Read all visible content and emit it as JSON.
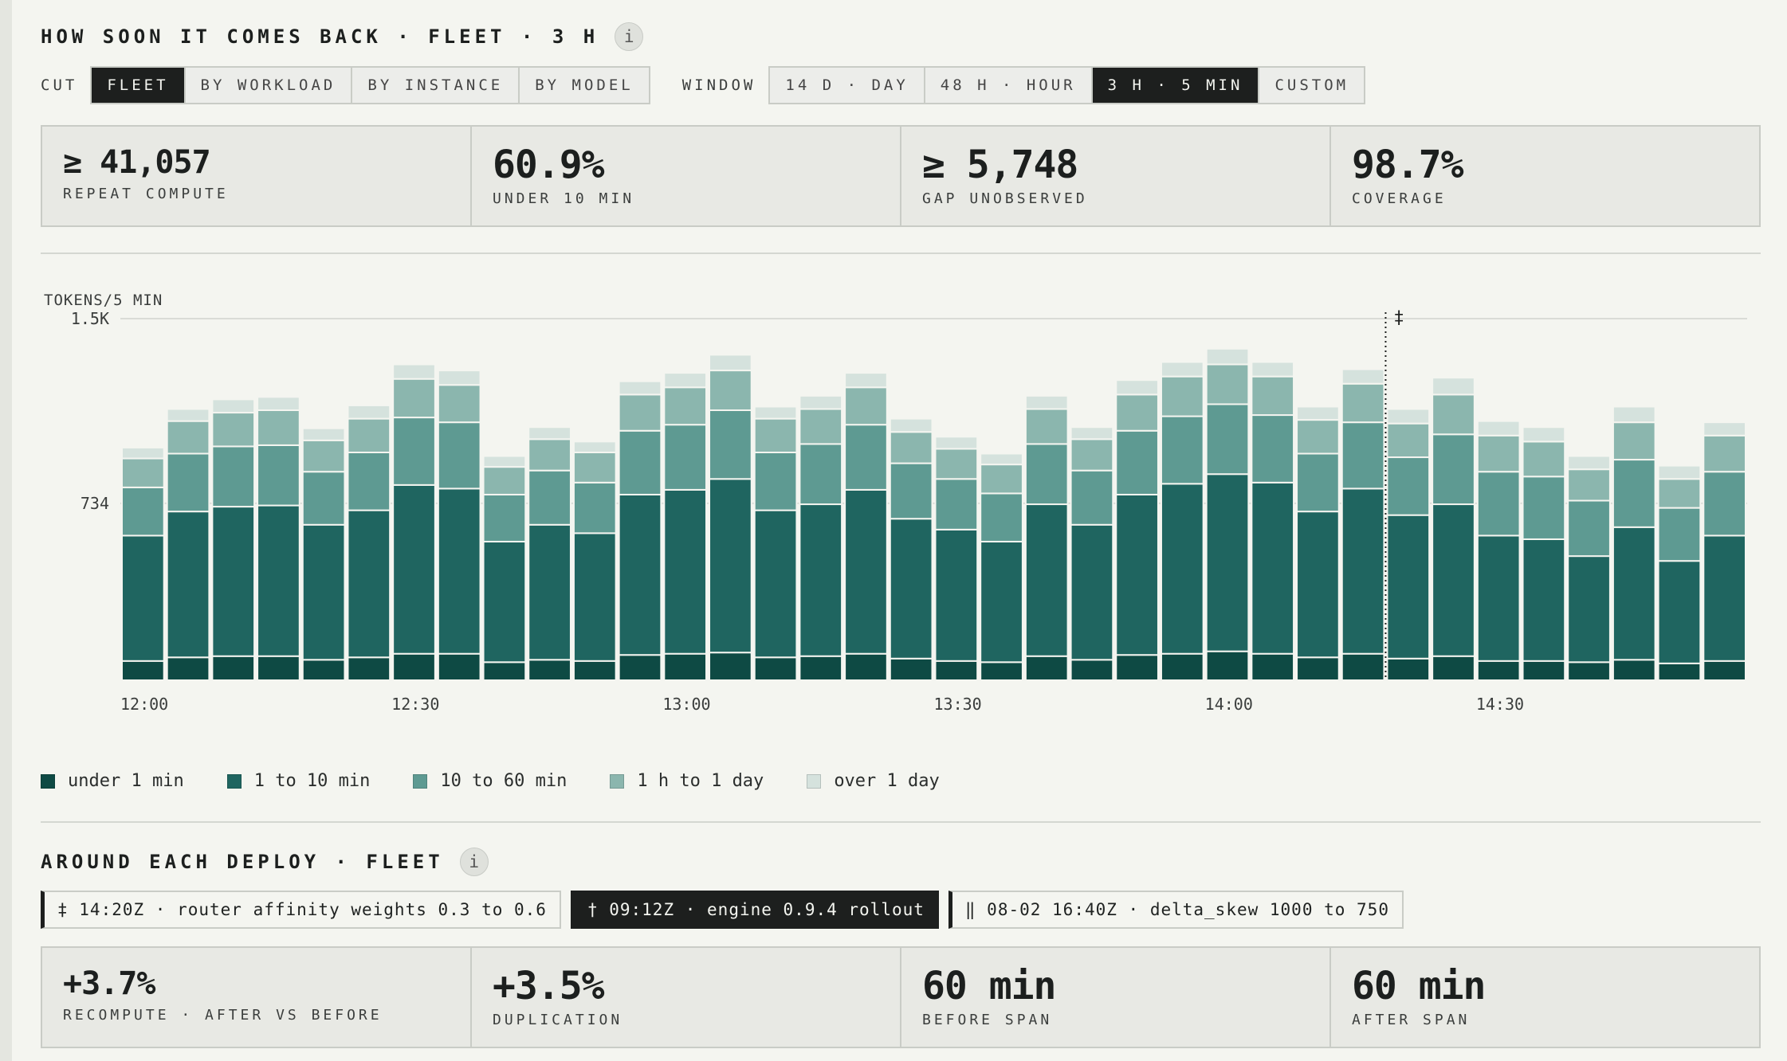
{
  "header": {
    "title": "HOW SOON IT COMES BACK · FLEET · 3 H",
    "info": "i"
  },
  "controls": {
    "cut_label": "CUT",
    "cut_options": [
      "FLEET",
      "BY WORKLOAD",
      "BY INSTANCE",
      "BY MODEL"
    ],
    "cut_active": "FLEET",
    "window_label": "WINDOW",
    "window_options": [
      "14 D · DAY",
      "48 H · HOUR",
      "3 H · 5 MIN",
      "CUSTOM"
    ],
    "window_active": "3 H · 5 MIN"
  },
  "kpis": [
    {
      "value": "≥ 41,057",
      "label": "REPEAT COMPUTE"
    },
    {
      "value": "60.9%",
      "label": "UNDER 10 MIN"
    },
    {
      "value": "≥ 5,748",
      "label": "GAP UNOBSERVED"
    },
    {
      "value": "98.7%",
      "label": "COVERAGE"
    }
  ],
  "colors": {
    "under_1_min": "#0e4a44",
    "1_to_10_min": "#1f6560",
    "10_to_60_min": "#5e9a92",
    "1_h_to_1_day": "#8bb6ae",
    "over_1_day": "#d5e2dd"
  },
  "chart_data": {
    "type": "bar",
    "stacked": true,
    "ylabel": "TOKENS/5 MIN",
    "ylim": [
      0,
      1500
    ],
    "yticks": [
      {
        "value": 734,
        "label": "734"
      },
      {
        "value": 1500,
        "label": "1.5K"
      }
    ],
    "xticks": [
      {
        "index": 0,
        "label": "12:00"
      },
      {
        "index": 6,
        "label": "12:30"
      },
      {
        "index": 12,
        "label": "13:00"
      },
      {
        "index": 18,
        "label": "13:30"
      },
      {
        "index": 24,
        "label": "14:00"
      },
      {
        "index": 30,
        "label": "14:30"
      }
    ],
    "marker": {
      "after_index": 27,
      "symbol": "‡"
    },
    "categories": [
      "12:00",
      "12:05",
      "12:10",
      "12:15",
      "12:20",
      "12:25",
      "12:30",
      "12:35",
      "12:40",
      "12:45",
      "12:50",
      "12:55",
      "13:00",
      "13:05",
      "13:10",
      "13:15",
      "13:20",
      "13:25",
      "13:30",
      "13:35",
      "13:40",
      "13:45",
      "13:50",
      "13:55",
      "14:00",
      "14:05",
      "14:10",
      "14:15",
      "14:20",
      "14:25",
      "14:30",
      "14:35",
      "14:40",
      "14:45",
      "14:50",
      "14:55"
    ],
    "series": [
      {
        "name": "under 1 min",
        "values": [
          80,
          95,
          100,
          100,
          85,
          95,
          110,
          110,
          75,
          85,
          80,
          105,
          110,
          115,
          95,
          100,
          110,
          90,
          80,
          75,
          100,
          85,
          105,
          110,
          120,
          110,
          95,
          110,
          90,
          100,
          80,
          80,
          75,
          85,
          70,
          80
        ]
      },
      {
        "name": "1 to 10 min",
        "values": [
          520,
          605,
          620,
          625,
          560,
          610,
          700,
          685,
          500,
          560,
          530,
          665,
          680,
          720,
          610,
          630,
          680,
          580,
          545,
          500,
          630,
          560,
          665,
          705,
          735,
          710,
          605,
          685,
          595,
          630,
          520,
          505,
          440,
          550,
          425,
          520
        ]
      },
      {
        "name": "10 to 60 min",
        "values": [
          200,
          240,
          250,
          250,
          220,
          240,
          280,
          275,
          195,
          225,
          210,
          265,
          270,
          285,
          240,
          250,
          270,
          230,
          210,
          200,
          250,
          225,
          265,
          280,
          290,
          280,
          240,
          275,
          240,
          290,
          265,
          260,
          230,
          280,
          220,
          265
        ]
      },
      {
        "name": "1 h to 1 day",
        "values": [
          120,
          135,
          140,
          145,
          130,
          140,
          160,
          155,
          115,
          130,
          125,
          150,
          155,
          165,
          140,
          145,
          155,
          130,
          125,
          120,
          145,
          130,
          150,
          165,
          165,
          160,
          140,
          160,
          140,
          165,
          150,
          145,
          130,
          155,
          120,
          150
        ]
      },
      {
        "name": "over 1 day",
        "values": [
          45,
          50,
          55,
          55,
          50,
          55,
          60,
          60,
          45,
          50,
          45,
          55,
          60,
          65,
          50,
          55,
          60,
          55,
          50,
          45,
          55,
          50,
          60,
          60,
          65,
          60,
          55,
          60,
          60,
          70,
          60,
          60,
          55,
          65,
          55,
          55
        ]
      }
    ]
  },
  "legend": [
    "under 1 min",
    "1 to 10 min",
    "10 to 60 min",
    "1 h to 1 day",
    "over 1 day"
  ],
  "deploy_section": {
    "title": "AROUND EACH DEPLOY · FLEET",
    "info": "i",
    "deploys": [
      "‡ 14:20Z · router affinity weights 0.3 to 0.6",
      "† 09:12Z · engine 0.9.4 rollout",
      "‖ 08-02 16:40Z · delta_skew 1000 to 750"
    ],
    "active_index": 1,
    "kpis": [
      {
        "value": "+3.7%",
        "label": "RECOMPUTE · AFTER VS BEFORE"
      },
      {
        "value": "+3.5%",
        "label": "DUPLICATION"
      },
      {
        "value": "60 min",
        "label": "BEFORE SPAN"
      },
      {
        "value": "60 min",
        "label": "AFTER SPAN"
      }
    ]
  }
}
